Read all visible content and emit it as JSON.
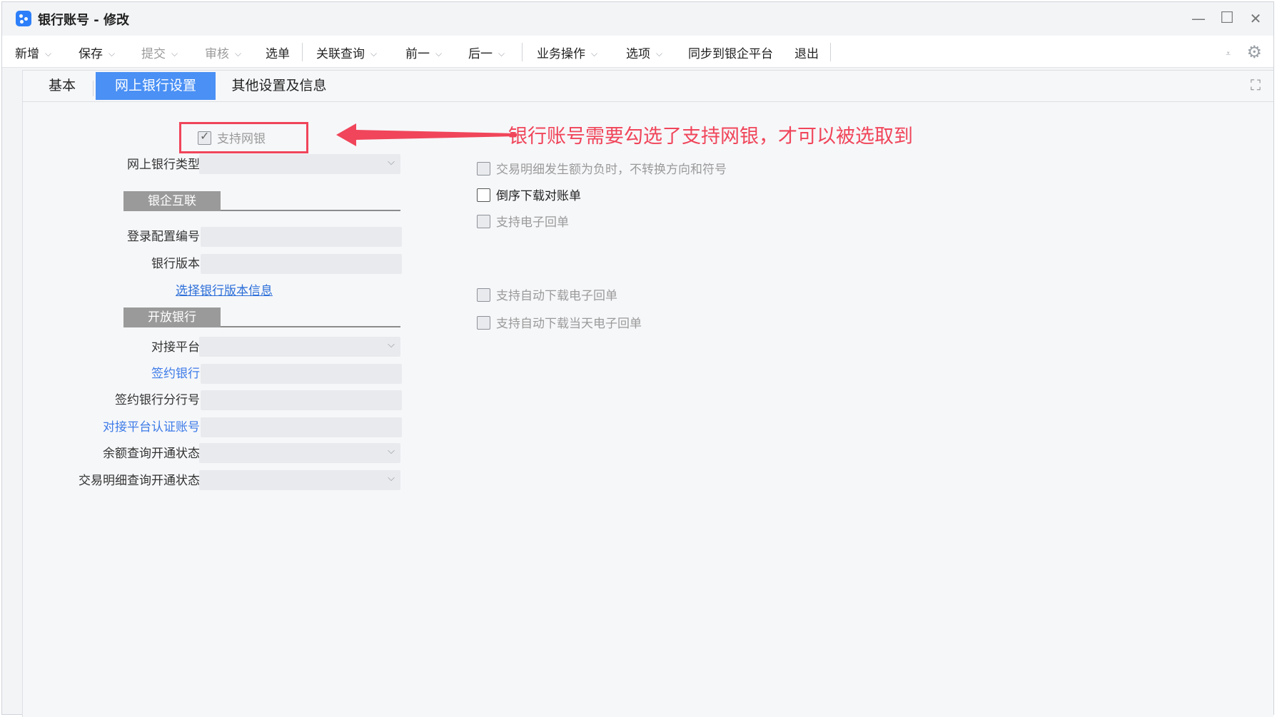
{
  "window": {
    "title": "银行账号 - 修改",
    "minimize_glyph": "—",
    "maximize_glyph": "☐",
    "close_glyph": "✕"
  },
  "toolbar": {
    "new": "新增",
    "save": "保存",
    "submit": "提交",
    "audit": "审核",
    "select_doc": "选单",
    "related_query": "关联查询",
    "prev": "前一",
    "next": "后一",
    "business_ops": "业务操作",
    "options": "选项",
    "sync": "同步到银企平台",
    "exit": "退出",
    "dropdown_glyph": "⌵",
    "small_glyph": "⩡",
    "settings_glyph": "⚙"
  },
  "tabs": [
    {
      "label": "基本",
      "active": false
    },
    {
      "label": "网上银行设置",
      "active": true
    },
    {
      "label": "其他设置及信息",
      "active": false
    }
  ],
  "expand_glyph": "⛶",
  "left_form": {
    "support_online_bank": {
      "label": "支持网银",
      "checked": true,
      "check_glyph": "✓"
    },
    "online_bank_type": {
      "label": "网上银行类型",
      "value": ""
    },
    "section_bank_enterprise": "银企互联",
    "login_config_no": {
      "label": "登录配置编号",
      "value": ""
    },
    "bank_version": {
      "label": "银行版本",
      "value": ""
    },
    "select_version_link": "选择银行版本信息",
    "section_open_bank": "开放银行",
    "platform": {
      "label": "对接平台",
      "value": ""
    },
    "contract_bank": {
      "label": "签约银行",
      "value": ""
    },
    "contract_branch_no": {
      "label": "签约银行分行号",
      "value": ""
    },
    "platform_auth_account": {
      "label": "对接平台认证账号",
      "value": ""
    },
    "balance_query_status": {
      "label": "余额查询开通状态",
      "value": ""
    },
    "detail_query_status": {
      "label": "交易明细查询开通状态",
      "value": ""
    },
    "dropdown_glyph": "⌵"
  },
  "right_form": {
    "no_convert_negative": {
      "label": "交易明细发生额为负时，不转换方向和符号",
      "checked": false,
      "enabled": false
    },
    "reverse_download": {
      "label": "倒序下载对账单",
      "checked": false,
      "enabled": true
    },
    "support_e_receipt": {
      "label": "支持电子回单",
      "checked": false,
      "enabled": false
    },
    "auto_download_receipt": {
      "label": "支持自动下载电子回单",
      "checked": false,
      "enabled": false
    },
    "auto_download_today_receipt": {
      "label": "支持自动下载当天电子回单",
      "checked": false,
      "enabled": false
    }
  },
  "annotation": {
    "text": "银行账号需要勾选了支持网银，才可以被选取到",
    "color": "#f0455a"
  },
  "colors": {
    "accent": "#4a90f5",
    "link": "#3d7be8",
    "annotation": "#f0455a"
  }
}
